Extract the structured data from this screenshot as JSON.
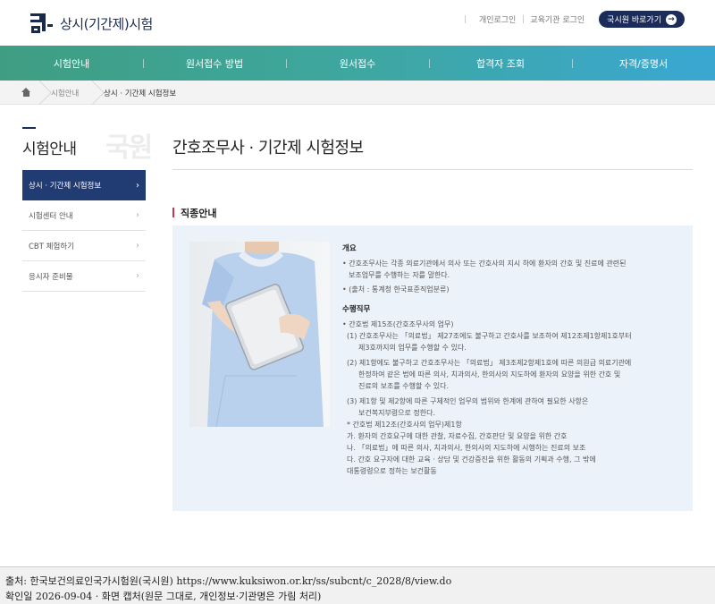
{
  "header": {
    "logo_mark": "국원",
    "title": "상시(기간제)시험",
    "links": [
      "개인로그인",
      "교육기관 로그인"
    ],
    "go_button": "국시원 바로가기",
    "go_arrow": "→"
  },
  "gnb": [
    "시험안내",
    "원서접수 방법",
    "원서접수",
    "합격자 조회",
    "자격/증명서"
  ],
  "breadcrumb": {
    "items": [
      "시험안내",
      "상시 · 기간제 시험정보"
    ]
  },
  "side": {
    "title": "시험안내",
    "watermark": "국원",
    "items": [
      {
        "label": "상시 · 기간제 시험정보",
        "active": true
      },
      {
        "label": "시험센터 안내",
        "active": false
      },
      {
        "label": "CBT 체험하기",
        "active": false
      },
      {
        "label": "응시자 준비물",
        "active": false
      }
    ],
    "chevron": "›"
  },
  "main": {
    "title": "간호조무사 · 기간제 시험정보",
    "section_title": "직종안내",
    "photo_alt": "nurse-holding-tablet",
    "overview_heading": "개요",
    "overview": [
      "• 간호조무사는 각종 의료기관에서 의사 또는 간호사의 지시 하에 환자의 간호 및 진료에 관련된",
      "보조업무를 수행하는 자를 말한다.",
      "• (출처 : 통계청 한국표준직업분류)"
    ],
    "duties_heading": "수행직무",
    "duties": [
      "• 간호법 제15조(간호조무사의 업무)",
      "(1) 간호조무사는 「의료법」 제27조에도 불구하고 간호사를 보조하여 제12조제1항제1호부터",
      "제3호까지의 업무를 수행할 수 있다.",
      "(2) 제1항에도 불구하고 간호조무사는 「의료법」 제3조제2항제1호에 따른 의원급 의료기관에",
      "한정하여 같은 법에 따른 의사, 치과의사, 한의사의 지도하에 환자의 요양을 위한 간호 및",
      "진료의 보조를 수행할 수 있다.",
      "(3) 제1항 및 제2항에 따른 구체적인 업무의 범위와 한계에 관하여 필요한 사항은",
      "보건복지부령으로 정한다.",
      "* 간호법 제12조(간호사의 업무)제1항",
      "가. 환자의 간호요구에 대한 관찰, 자료수집, 간호판단 및 요양을 위한 간호",
      "나. 「의료법」에 따른 의사, 치과의사, 한의사의 지도하에 시행하는 진료의 보조",
      "다. 간호 요구자에 대한 교육 · 상담 및 건강증진을 위한 활동의 기획과 수행, 그 밖에",
      "대통령령으로 정하는 보건활동"
    ]
  },
  "footer": {
    "source": "출처: 한국보건의료인국가시험원(국시원)  https://www.kuksiwon.or.kr/ss/subcnt/c_2028/8/view.do",
    "confirm": "확인일 2026-09-04 · 화면 캡처(원문 그대로, 개인정보·기관명은 가림 처리)"
  }
}
